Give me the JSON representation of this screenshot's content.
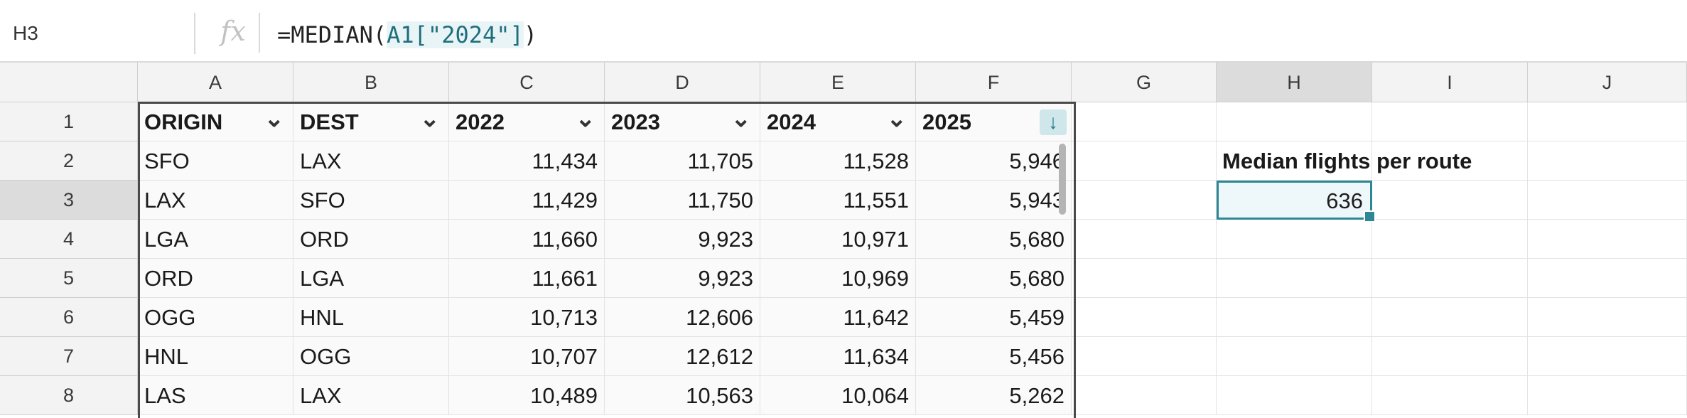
{
  "formula_bar": {
    "name_box": "H3",
    "fx_label": "fx",
    "formula_prefix": "=MEDIAN(",
    "formula_ref": "A1[",
    "formula_str": "\"2024\"",
    "formula_ref_end": "]",
    "formula_suffix": ")"
  },
  "columns": [
    "A",
    "B",
    "C",
    "D",
    "E",
    "F",
    "G",
    "H",
    "I",
    "J"
  ],
  "rows": [
    "1",
    "2",
    "3",
    "4",
    "5",
    "6",
    "7",
    "8"
  ],
  "active_cell": {
    "column": "H",
    "row": "3"
  },
  "table": {
    "headers": [
      "ORIGIN",
      "DEST",
      "2022",
      "2023",
      "2024",
      "2025"
    ],
    "rows": [
      [
        "SFO",
        "LAX",
        "11,434",
        "11,705",
        "11,528",
        "5,946"
      ],
      [
        "LAX",
        "SFO",
        "11,429",
        "11,750",
        "11,551",
        "5,943"
      ],
      [
        "LGA",
        "ORD",
        "11,660",
        "9,923",
        "10,971",
        "5,680"
      ],
      [
        "ORD",
        "LGA",
        "11,661",
        "9,923",
        "10,969",
        "5,680"
      ],
      [
        "OGG",
        "HNL",
        "10,713",
        "12,606",
        "11,642",
        "5,459"
      ],
      [
        "HNL",
        "OGG",
        "10,707",
        "12,612",
        "11,634",
        "5,456"
      ],
      [
        "LAS",
        "LAX",
        "10,489",
        "10,563",
        "10,064",
        "5,262"
      ]
    ],
    "sorted_column": "2025",
    "sort_direction": "descending"
  },
  "side": {
    "label": "Median flights per route",
    "result": "636"
  },
  "colors": {
    "accent": "#2e8795",
    "header_bg": "#f3f3f3",
    "active_header_bg": "#dcdcdc",
    "selection_fill": "#eef7f9"
  },
  "icons": {
    "fx": "function-icon",
    "filter": "chevron-down-icon",
    "sort": "arrow-down-icon"
  }
}
